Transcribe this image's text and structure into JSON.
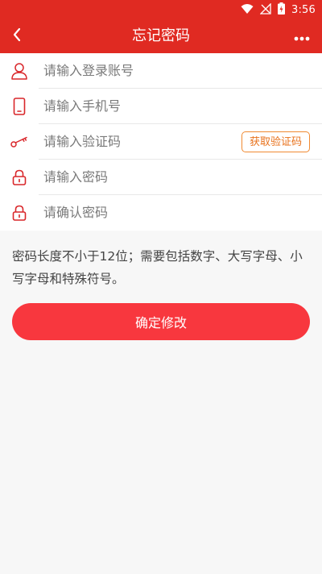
{
  "status_bar": {
    "time": "3:56",
    "icons": [
      "wifi-icon",
      "no-signal-icon",
      "battery-charging-icon"
    ]
  },
  "app_bar": {
    "title": "忘记密码",
    "back_icon": "chevron-left-icon",
    "more_icon": "more-dots-icon"
  },
  "form": {
    "fields": [
      {
        "icon": "user-icon",
        "placeholder": "请输入登录账号",
        "value": ""
      },
      {
        "icon": "phone-icon",
        "placeholder": "请输入手机号",
        "value": ""
      },
      {
        "icon": "key-icon",
        "placeholder": "请输入验证码",
        "value": ""
      },
      {
        "icon": "lock-icon",
        "placeholder": "请输入密码",
        "value": ""
      },
      {
        "icon": "lock-icon",
        "placeholder": "请确认密码",
        "value": ""
      }
    ],
    "get_code_label": "获取验证码"
  },
  "hint": "密码长度不小于12位；需要包括数字、大写字母、小写字母和特殊符号。",
  "submit_label": "确定修改",
  "colors": {
    "header": "#e02a22",
    "icon": "#d9262a",
    "code_button": "#f08a32",
    "submit": "#f8373e",
    "background": "#f7f7f7"
  }
}
